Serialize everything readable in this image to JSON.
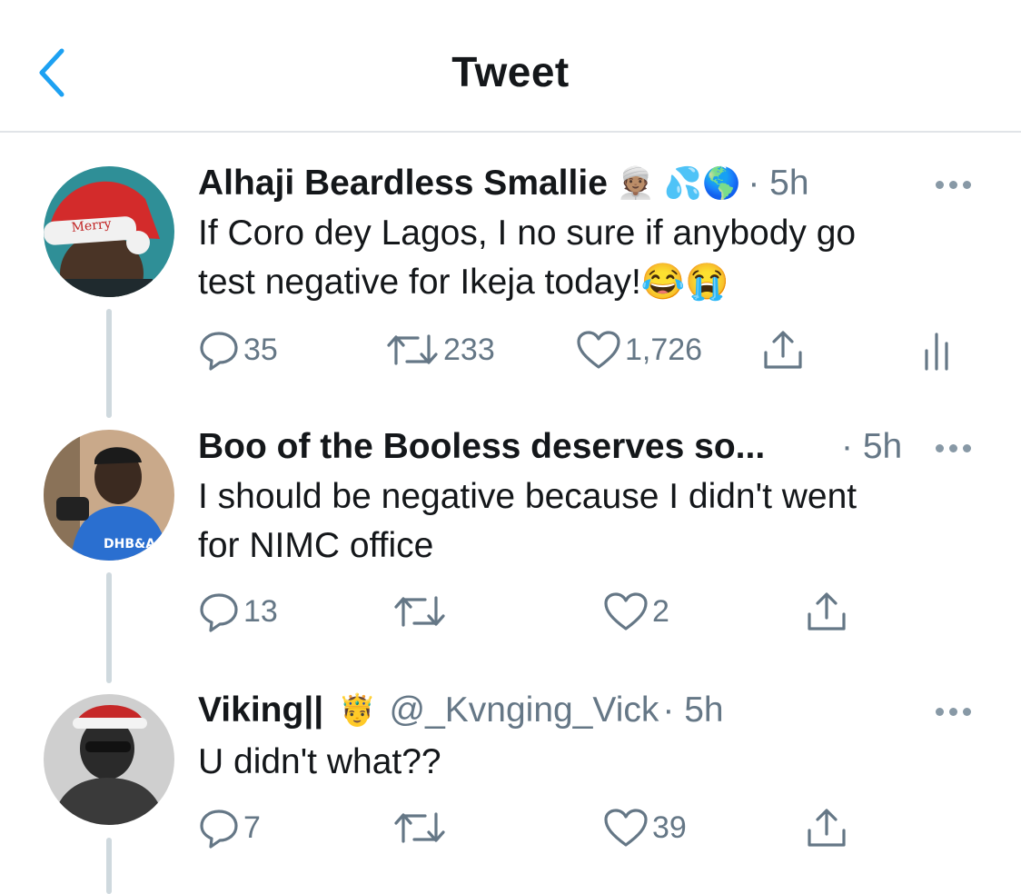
{
  "header": {
    "title": "Tweet"
  },
  "tweets": [
    {
      "name": "Alhaji Beardless Smallie",
      "emojis": "👳🏽 💦🌎",
      "handle": "",
      "time": "· 5h",
      "text_lines": [
        "If Coro dey Lagos, I no sure if anybody go",
        "test negative for Ikeja today!😂😭"
      ],
      "replies": "35",
      "retweets": "233",
      "likes": "1,726",
      "has_analytics": true
    },
    {
      "name": "Boo of the Booless deserves so...",
      "emojis": "",
      "handle": "",
      "time": "· 5h",
      "text_lines": [
        "I should be negative because I didn't went",
        "for NIMC office"
      ],
      "replies": "13",
      "retweets": "",
      "likes": "2",
      "has_analytics": false
    },
    {
      "name": "Viking||",
      "emojis": "🤴",
      "handle": "@_Kvnging_Vick",
      "time": "· 5h",
      "text_lines": [
        "U didn't what??"
      ],
      "replies": "7",
      "retweets": "",
      "likes": "39",
      "has_analytics": false
    }
  ],
  "icons": {
    "back": "chevron-left-icon",
    "reply": "reply-icon",
    "retweet": "retweet-icon",
    "like": "heart-icon",
    "share": "share-icon",
    "analytics": "analytics-icon",
    "more": "more-icon"
  },
  "colors": {
    "accent": "#1da1f2",
    "secondary_text": "#657786",
    "thread_line": "#cfd9de"
  }
}
